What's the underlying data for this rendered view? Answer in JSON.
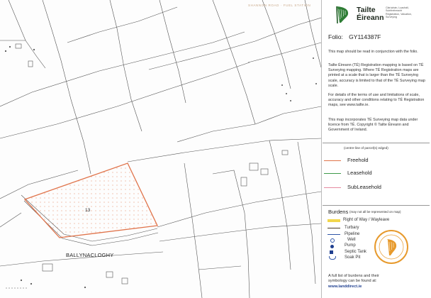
{
  "brand": {
    "name_line1": "Tailte",
    "name_line2": "Éireann",
    "sub_line1": "Clárúchán, Luacháil,",
    "sub_line2": "Suirbhéireacht",
    "sub_line3": "Registration, Valuation,",
    "sub_line4": "Surveying"
  },
  "folio": {
    "label": "Folio:",
    "value": "GY114387F"
  },
  "notes": {
    "p1": "This map should be read in conjunction with the folio.",
    "p2": "Tailte Éireann (TÉ) Registration mapping is based on TÉ Surveying mapping. Where TÉ Registration maps are printed at a scale that is larger than the TÉ Surveying scale, accuracy is limited to that of the TÉ Surveying map scale.",
    "p3": "For details of the terms of use and limitations of scale, accuracy and other conditions relating to TÉ Registration maps, see www.tailte.ie.",
    "p4": "This map incorporates TÉ Surveying map data under licence from TÉ. Copyright © Tailte Éireann and Government of Ireland."
  },
  "tenure": {
    "caption": "(centre-line of parcel(s) edged)",
    "items": [
      {
        "label": "Freehold",
        "color": "#e0734a"
      },
      {
        "label": "Leasehold",
        "color": "#3f9a4a"
      },
      {
        "label": "SubLeasehold",
        "color": "#e58aa0"
      }
    ]
  },
  "burdens": {
    "title": "Burdens",
    "caption": "(may not all be represented on map)",
    "items": [
      {
        "label": "Right of Way / Wayleave",
        "icon": "yellow-band-icon",
        "color": "#f2d64b"
      },
      {
        "label": "Turbary",
        "icon": "dark-line-icon",
        "color": "#4a3a2a"
      },
      {
        "label": "Pipeline",
        "icon": "blue-line-icon",
        "color": "#2f55a8"
      },
      {
        "label": "Well",
        "icon": "open-circle-icon",
        "color": "#2f55a8"
      },
      {
        "label": "Pump",
        "icon": "filled-circle-icon",
        "color": "#1f3f8f"
      },
      {
        "label": "Septic Tank",
        "icon": "square-icon",
        "color": "#1f3f8f"
      },
      {
        "label": "Soak Pit",
        "icon": "cup-icon",
        "color": "#2f55a8"
      }
    ]
  },
  "footer": {
    "line1": "A full list of burdens and their",
    "line2": "symbology can be found at:",
    "url": "www.landdirect.ie"
  },
  "map": {
    "parcel_number": "13",
    "townland": "BALLYNACLOGHY",
    "top_text": "SHANNON ROAD · FUEL STATION"
  },
  "colors": {
    "freehold_outline": "#e0734a",
    "seal": "#e79a2d",
    "harp": "#2e7d35"
  }
}
